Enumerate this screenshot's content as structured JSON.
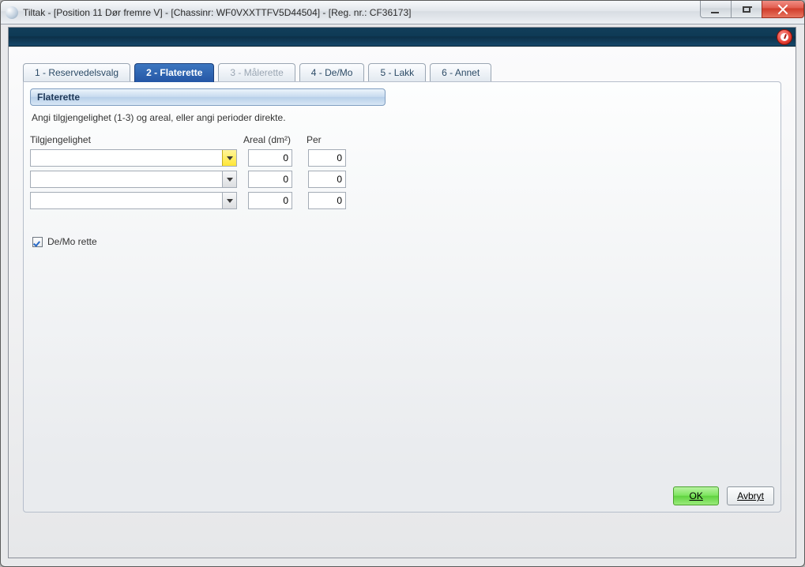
{
  "window": {
    "title": "Tiltak - [Position 11 Dør fremre V] - [Chassinr: WF0VXXTTFV5D44504] - [Reg. nr.: CF36173]"
  },
  "tabs": [
    {
      "label": "1 - Reservedelsvalg"
    },
    {
      "label": "2 - Flaterette"
    },
    {
      "label": "3 - Målerette"
    },
    {
      "label": "4 - De/Mo"
    },
    {
      "label": "5 - Lakk"
    },
    {
      "label": "6 - Annet"
    }
  ],
  "section": {
    "title": "Flaterette"
  },
  "hint": "Angi tilgjengelighet (1-3) og areal, eller angi perioder direkte.",
  "columns": {
    "tilgjengelighet": "Tilgjengelighet",
    "areal": "Areal (dm²)",
    "per": "Per"
  },
  "rows": [
    {
      "tilgjengelighet": "",
      "areal": "0",
      "per": "0"
    },
    {
      "tilgjengelighet": "",
      "areal": "0",
      "per": "0"
    },
    {
      "tilgjengelighet": "",
      "areal": "0",
      "per": "0"
    }
  ],
  "checkbox": {
    "label": "De/Mo rette",
    "checked": true
  },
  "buttons": {
    "ok": "OK",
    "cancel": "Avbryt"
  }
}
